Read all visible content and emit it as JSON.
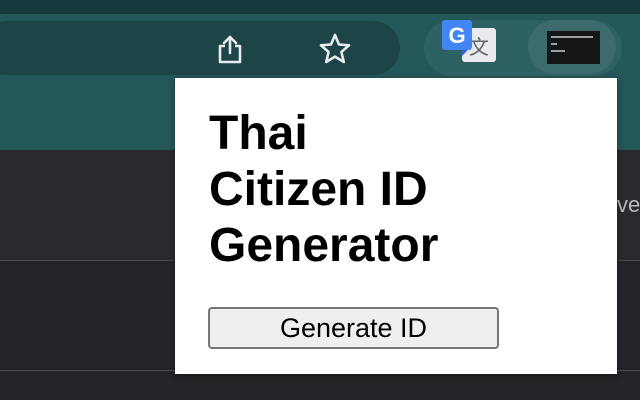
{
  "toolbar": {
    "icons": [
      "share-icon",
      "star-icon",
      "google-translate-icon",
      "extension-thumbnail-icon"
    ]
  },
  "background": {
    "side_text": "ve"
  },
  "popup": {
    "title": "Thai\nCitizen ID\nGenerator",
    "button_label": "Generate ID"
  },
  "colors": {
    "toolbar": "#24575a",
    "top_strip": "#173a3c",
    "page_background": "#242428",
    "popup_background": "#ffffff",
    "button_background": "#efefef"
  }
}
